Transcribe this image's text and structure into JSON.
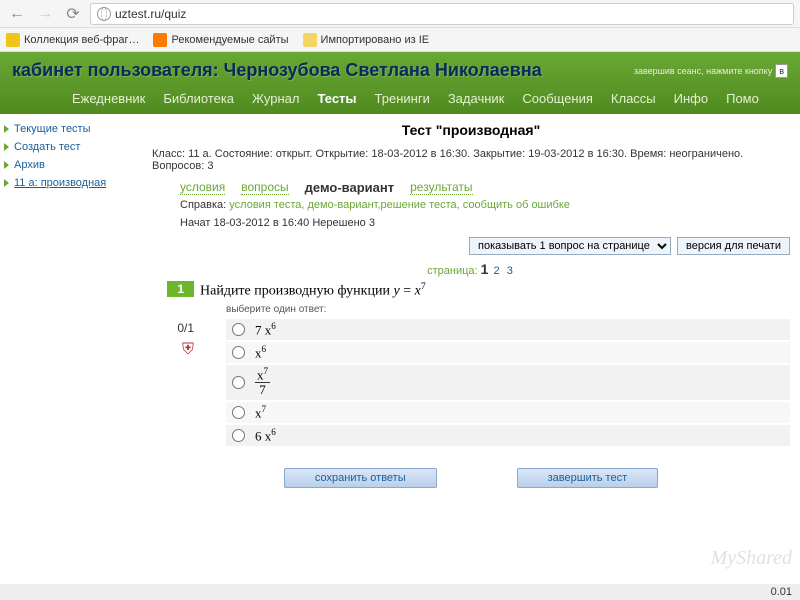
{
  "browser": {
    "url": "uztest.ru/quiz",
    "bookmarks": [
      {
        "label": "Коллекция веб-фраг…"
      },
      {
        "label": "Рекомендуемые сайты"
      },
      {
        "label": "Импортировано из IE"
      }
    ]
  },
  "header": {
    "title": "кабинет пользователя: Чернозубова Светлана Николаевна",
    "session_note": "завершив сеанс, нажмите кнопку",
    "nav": [
      "Ежедневник",
      "Библиотека",
      "Журнал",
      "Тесты",
      "Тренинги",
      "Задачник",
      "Сообщения",
      "Классы",
      "Инфо",
      "Помо"
    ],
    "active_nav": "Тесты"
  },
  "sidebar": {
    "items": [
      {
        "label": "Текущие тесты"
      },
      {
        "label": "Создать тест"
      },
      {
        "label": "Архив"
      },
      {
        "label": "11 а: производная",
        "link": true
      }
    ]
  },
  "test": {
    "title": "Тест \"производная\"",
    "meta": {
      "class_lbl": "Класс:",
      "class": "11 а.",
      "state_lbl": "Состояние:",
      "state": "открыт.",
      "open_lbl": "Открытие:",
      "open": "18-03-2012 в 16:30.",
      "close_lbl": "Закрытие:",
      "close": "19-03-2012 в 16:30.",
      "time_lbl": "Время:",
      "time": "неограничено.",
      "qcount_lbl": "Вопросов:",
      "qcount": "3"
    },
    "tabs": [
      "условия",
      "вопросы",
      "демо-вариант",
      "результаты"
    ],
    "active_tab": "демо-вариант",
    "help_lbl": "Справка:",
    "help": "условия теста, демо-вариант,решение теста, сообщить об ошибке",
    "started": "Начат 18-03-2012 в 16:40   Нерешено 3",
    "select_label": "показывать 1 вопрос на странице",
    "print_btn": "версия для печати",
    "pager_lbl": "страница:",
    "pages": [
      "1",
      "2",
      "3"
    ],
    "current_page": "1",
    "question": {
      "num": "1",
      "score": "0/1",
      "text_prefix": "Найдите производную функции ",
      "formula": "y = x⁷",
      "instr": "выберите один ответ:",
      "answers": [
        {
          "html": "7 x<sup>6</sup>"
        },
        {
          "html": "x<sup>6</sup>"
        },
        {
          "html": "<span class='frac'><span class='top'>x<sup>7</sup></span><span class='bot'>7</span></span>"
        },
        {
          "html": "x<sup>7</sup>"
        },
        {
          "html": "6 x<sup>6</sup>"
        }
      ]
    },
    "btn_save": "сохранить ответы",
    "btn_finish": "завершить тест"
  },
  "footer_timer": "0.01",
  "watermark": "MyShared"
}
